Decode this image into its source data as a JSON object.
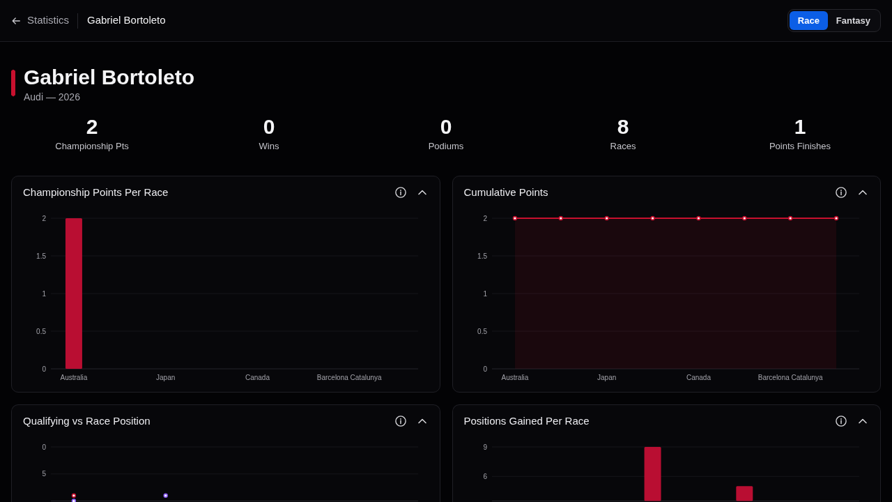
{
  "header": {
    "back_label": "Statistics",
    "current_page": "Gabriel Bortoleto"
  },
  "mode_tabs": [
    {
      "label": "Race",
      "selected": true
    },
    {
      "label": "Fantasy",
      "selected": false
    }
  ],
  "driver": {
    "name": "Gabriel Bortoleto",
    "team_season": "Audi — 2026"
  },
  "stats": [
    {
      "value": "2",
      "label": "Championship Pts"
    },
    {
      "value": "0",
      "label": "Wins"
    },
    {
      "value": "0",
      "label": "Podiums"
    },
    {
      "value": "8",
      "label": "Races"
    },
    {
      "value": "1",
      "label": "Points Finishes"
    }
  ],
  "charts": [
    {
      "title": "Championship Points Per Race",
      "expanded": true,
      "chart_data": {
        "type": "bar",
        "categories": [
          "Australia",
          null,
          "Japan",
          null,
          "Canada",
          null,
          "Barcelona Catalunya",
          null
        ],
        "ylim": [
          0,
          2
        ],
        "yticks": [
          0,
          0.5,
          1,
          1.5,
          2
        ],
        "grid": true,
        "series": [
          {
            "color": "#b90e32",
            "values": [
              2,
              0,
              0,
              0,
              0,
              0,
              0,
              0
            ]
          }
        ]
      }
    },
    {
      "title": "Cumulative Points",
      "expanded": true,
      "chart_data": {
        "type": "area",
        "categories": [
          "Australia",
          null,
          "Japan",
          null,
          "Canada",
          null,
          "Barcelona Catalunya",
          null
        ],
        "ylim": [
          0,
          2
        ],
        "yticks": [
          0,
          0.5,
          1,
          1.5,
          2
        ],
        "grid": true,
        "series": [
          {
            "color": "#c8102e",
            "marker": true,
            "values": [
              2,
              2,
              2,
              2,
              2,
              2,
              2,
              2
            ]
          }
        ]
      }
    },
    {
      "title": "Qualifying vs Race Position",
      "expanded": true,
      "chart_data": {
        "type": "scatter",
        "categories": [
          null,
          null,
          null,
          null,
          null,
          null,
          null,
          null
        ],
        "ylim": [
          10,
          0
        ],
        "yticks": [
          0,
          5
        ],
        "grid": true,
        "series": [
          {
            "color": "#c8102e",
            "values": [
              9,
              null,
              null,
              null,
              null,
              null,
              null,
              null
            ]
          },
          {
            "color": "#8b5cf6",
            "values": [
              10,
              null,
              9,
              null,
              null,
              null,
              null,
              null
            ]
          }
        ]
      }
    },
    {
      "title": "Positions Gained Per Race",
      "expanded": true,
      "chart_data": {
        "type": "bar",
        "categories": [
          null,
          null,
          null,
          null,
          null,
          null,
          null,
          null
        ],
        "ylim": [
          3.5,
          9
        ],
        "yticks": [
          6,
          9
        ],
        "grid": true,
        "series": [
          {
            "color": "#b90e32",
            "values": [
              null,
              null,
              null,
              9,
              null,
              5,
              null,
              null
            ]
          }
        ]
      }
    }
  ]
}
